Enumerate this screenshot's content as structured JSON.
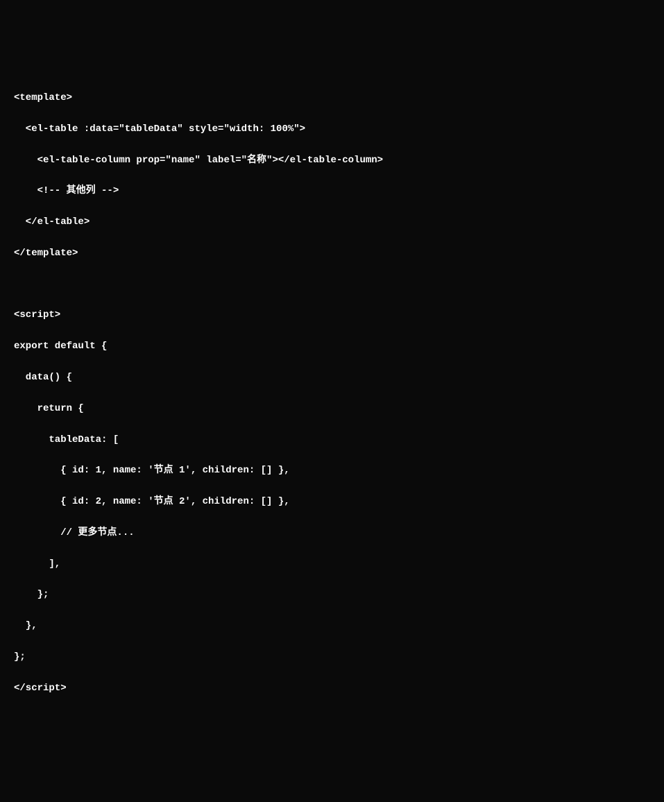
{
  "code": {
    "lines": [
      "<template>",
      "  <el-table :data=\"tableData\" style=\"width: 100%\">",
      "    <el-table-column prop=\"name\" label=\"名称\"></el-table-column>",
      "    <!-- 其他列 -->",
      "  </el-table>",
      "</template>",
      "",
      "<script>",
      "export default {",
      "  data() {",
      "    return {",
      "      tableData: [",
      "        { id: 1, name: '节点 1', children: [] },",
      "        { id: 2, name: '节点 2', children: [] },",
      "        // 更多节点...",
      "      ],",
      "    };",
      "  },",
      "};",
      "</script>"
    ]
  }
}
